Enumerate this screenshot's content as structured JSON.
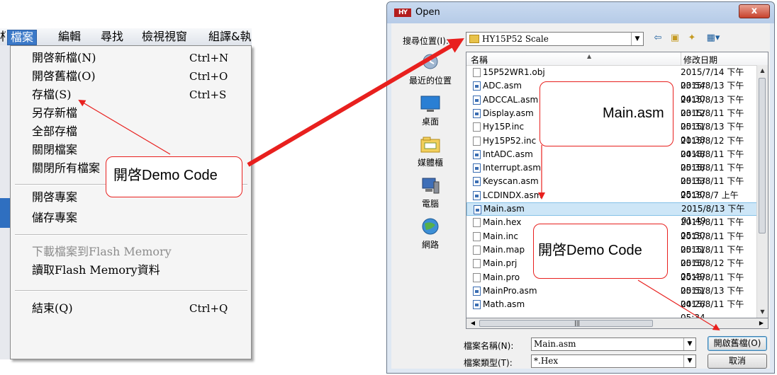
{
  "menubar": {
    "edge_char": "朽",
    "items": [
      "檔案",
      "編輯",
      "尋找",
      "檢視視窗",
      "組譯&執"
    ]
  },
  "file_menu": {
    "items": [
      {
        "label": "開啓新檔(N)",
        "shortcut": "Ctrl+N"
      },
      {
        "label": "開啓舊檔(O)",
        "shortcut": "Ctrl+O"
      },
      {
        "label": "存檔(S)",
        "shortcut": "Ctrl+S"
      },
      {
        "label": "另存新檔",
        "shortcut": ""
      },
      {
        "label": "全部存檔",
        "shortcut": ""
      },
      {
        "label": "關閉檔案",
        "shortcut": ""
      },
      {
        "label": "關閉所有檔案",
        "shortcut": ""
      },
      {
        "label": "開啓專案",
        "shortcut": ""
      },
      {
        "label": "儲存專案",
        "shortcut": ""
      },
      {
        "label": "下載檔案到Flash Memory",
        "shortcut": "",
        "disabled": true
      },
      {
        "label": "讀取Flash Memory資料",
        "shortcut": ""
      },
      {
        "label": "結束(Q)",
        "shortcut": "Ctrl+Q"
      }
    ]
  },
  "callouts": {
    "open_demo_left": "開啓Demo Code",
    "main_asm": "Main.asm",
    "open_demo_right": "開啓Demo Code"
  },
  "dialog": {
    "app_logo": "HY",
    "title": "Open",
    "close": "x",
    "look_in_label": "搜尋位置(I):",
    "look_in_value": "HY15P52 Scale",
    "places": [
      {
        "label": "最近的位置",
        "icon": "recent-places-icon"
      },
      {
        "label": "桌面",
        "icon": "desktop-icon"
      },
      {
        "label": "媒體櫃",
        "icon": "libraries-icon"
      },
      {
        "label": "電腦",
        "icon": "computer-icon"
      },
      {
        "label": "網路",
        "icon": "network-icon"
      }
    ],
    "columns": {
      "name": "名稱",
      "date": "修改日期"
    },
    "files": [
      {
        "name": "15P52WR1.obj",
        "date": "2015/7/14 下午 03:54",
        "type": "file"
      },
      {
        "name": "ADC.asm",
        "date": "2015/8/13 下午 04:30",
        "type": "asm"
      },
      {
        "name": "ADCCAL.asm",
        "date": "2015/8/13 下午 03:12",
        "type": "asm"
      },
      {
        "name": "Display.asm",
        "date": "2015/8/11 下午 05:31",
        "type": "asm"
      },
      {
        "name": "Hy15P.inc",
        "date": "2015/8/13 下午 01:38",
        "type": "file"
      },
      {
        "name": "Hy15P52.inc",
        "date": "2015/8/12 下午 04:48",
        "type": "file"
      },
      {
        "name": "IntADC.asm",
        "date": "2015/8/11 下午 05:38",
        "type": "asm"
      },
      {
        "name": "Interrupt.asm",
        "date": "2015/8/11 下午 05:33",
        "type": "asm"
      },
      {
        "name": "Keyscan.asm",
        "date": "2015/8/11 下午 05:30",
        "type": "asm"
      },
      {
        "name": "LCDINDX.asm",
        "date": "2015/8/7 上午 11:30",
        "type": "asm"
      },
      {
        "name": "Main.asm",
        "date": "2015/8/13 下午 01:49",
        "type": "asm",
        "selected": true
      },
      {
        "name": "Main.hex",
        "date": "2015/8/11 下午 05:50",
        "type": "file"
      },
      {
        "name": "Main.inc",
        "date": "2015/8/11 下午 05:31",
        "type": "file"
      },
      {
        "name": "Main.map",
        "date": "2015/8/11 下午 05:50",
        "type": "file"
      },
      {
        "name": "Main.prj",
        "date": "2015/8/12 下午 05:49",
        "type": "file"
      },
      {
        "name": "Main.pro",
        "date": "2015/8/11 下午 05:51",
        "type": "file"
      },
      {
        "name": "MainPro.asm",
        "date": "2015/8/13 下午 04:26",
        "type": "asm"
      },
      {
        "name": "Math.asm",
        "date": "2015/8/11 下午 05:34",
        "type": "asm"
      }
    ],
    "file_name_label": "檔案名稱(N):",
    "file_name_value": "Main.asm",
    "file_type_label": "檔案類型(T):",
    "file_type_value": "*.Hex",
    "open_button": "開啟舊檔(O)",
    "cancel_button": "取消"
  },
  "colors": {
    "annotation": "#e8201e",
    "selection": "#cde6f7"
  }
}
